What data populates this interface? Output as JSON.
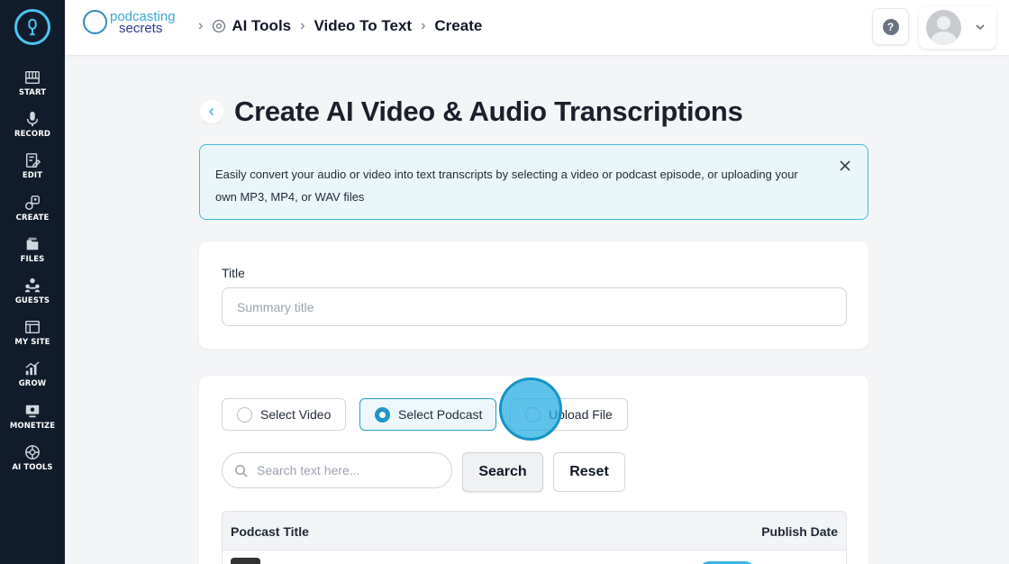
{
  "sidebar": {
    "logo_icon": "podcast-logo-icon",
    "items": [
      {
        "label": "START",
        "icon": "piano-icon"
      },
      {
        "label": "RECORD",
        "icon": "microphone-icon"
      },
      {
        "label": "EDIT",
        "icon": "edit-icon"
      },
      {
        "label": "CREATE",
        "icon": "create-icon"
      },
      {
        "label": "FILES",
        "icon": "files-icon"
      },
      {
        "label": "GUESTS",
        "icon": "guests-icon"
      },
      {
        "label": "MY SITE",
        "icon": "site-icon"
      },
      {
        "label": "GROW",
        "icon": "chart-icon"
      },
      {
        "label": "MONETIZE",
        "icon": "monetize-icon"
      },
      {
        "label": "AI TOOLS",
        "icon": "ai-icon"
      }
    ]
  },
  "header": {
    "brand_line1": "podcasting",
    "brand_line2": "secrets",
    "breadcrumb": [
      "AI Tools",
      "Video To Text",
      "Create"
    ],
    "help_label": "?"
  },
  "page": {
    "title": "Create AI Video & Audio Transcriptions",
    "info_text": "Easily convert your audio or video into text transcripts by selecting a video or podcast episode, or uploading your own MP3, MP4, or WAV files"
  },
  "title_form": {
    "label": "Title",
    "placeholder": "Summary title",
    "value": ""
  },
  "source": {
    "options": [
      "Select Video",
      "Select Podcast",
      "Upload File"
    ],
    "selected": "Select Podcast"
  },
  "search": {
    "placeholder": "Search text here...",
    "search_label": "Search",
    "reset_label": "Reset"
  },
  "table": {
    "columns": [
      "Podcast Title",
      "Publish Date"
    ]
  },
  "colors": {
    "sidebar_bg": "#101c2b",
    "accent": "#2196c9",
    "info_bg": "#eaf7fa",
    "info_border": "#4ab8d8"
  }
}
